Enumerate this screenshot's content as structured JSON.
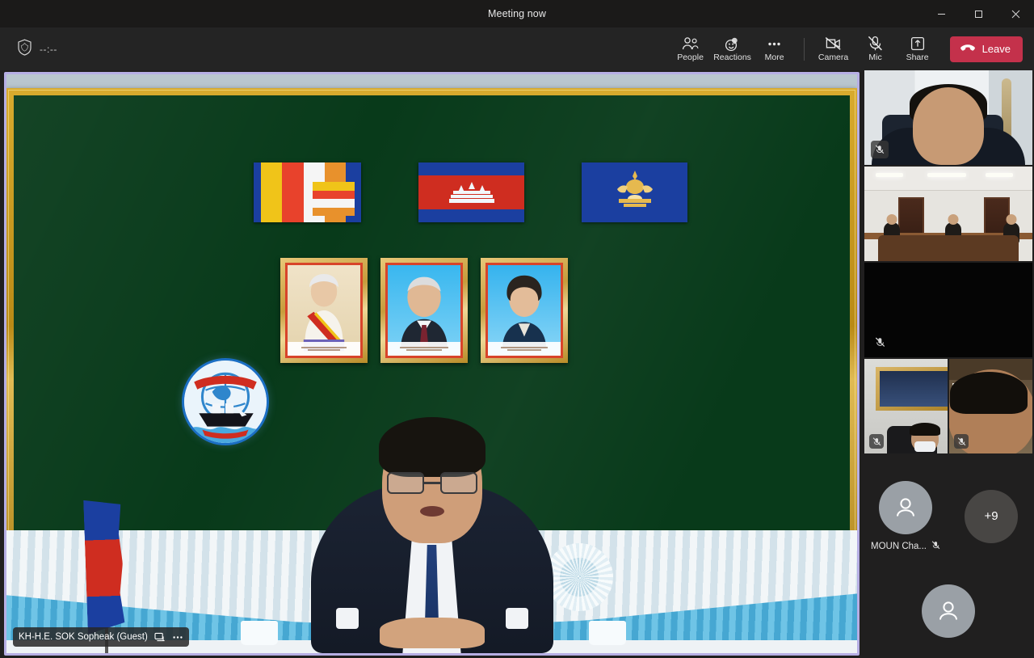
{
  "window": {
    "title": "Meeting now",
    "controls": [
      {
        "name": "minimize",
        "glyph": "–"
      },
      {
        "name": "maximize",
        "glyph": "❐"
      },
      {
        "name": "close",
        "glyph": "✕"
      }
    ]
  },
  "toolbar": {
    "shield_icon": "shield-icon",
    "timer": "--:--",
    "items": [
      {
        "label": "People",
        "icon": "people-icon"
      },
      {
        "label": "Reactions",
        "icon": "reactions-icon"
      },
      {
        "label": "More",
        "icon": "more-ellipsis-icon"
      },
      {
        "label": "Camera",
        "icon": "camera-off-icon"
      },
      {
        "label": "Mic",
        "icon": "mic-off-icon"
      },
      {
        "label": "Share",
        "icon": "share-tray-icon"
      }
    ],
    "leave_label": "Leave",
    "leave_color": "#c4314b"
  },
  "stage": {
    "active_speaker_border": "#b6aee4",
    "main_tile": {
      "name_label": "KH-H.E. SOK Sopheak (Guest)",
      "pin_icon": "pin-share-icon",
      "more_icon": "more-ellipsis-icon",
      "scene": {
        "backdrop": "dark-green-board",
        "board_color": "#083a1a",
        "frame_color": "#c79c2a",
        "wall_color": "#b3c1cb",
        "flags": [
          {
            "name": "buddhist-flag",
            "colors": [
              "#1b3fa0",
              "#f0c419",
              "#e8422c",
              "#ffffff",
              "#e8912c"
            ]
          },
          {
            "name": "cambodia-flag",
            "colors": [
              "#1b3fa0",
              "#cf2d20",
              "#ffffff"
            ]
          },
          {
            "name": "royal-standard-flag",
            "colors": [
              "#1b3fa0",
              "#e0b24a"
            ]
          }
        ],
        "portraits": [
          {
            "name": "king-portrait"
          },
          {
            "name": "king-father-portrait"
          },
          {
            "name": "queen-mother-portrait"
          }
        ],
        "emblem": {
          "name": "maritime-ship-emblem",
          "colors": [
            "#1b6fc4",
            "#cf2d20",
            "#ffffff"
          ]
        },
        "table_skirt_colors": [
          "#f2f6f8",
          "#46a7d2"
        ],
        "speaker": {
          "suit": "#1b2333",
          "tie": "#23407c",
          "glasses": true
        }
      }
    }
  },
  "roster": {
    "tiles": [
      {
        "name": "roster-tile-office",
        "muted": true,
        "camera_on": true
      },
      {
        "name": "roster-tile-conference-room",
        "muted": false,
        "camera_on": true
      },
      {
        "name": "roster-tile-camera-off",
        "muted": true,
        "camera_on": false
      },
      {
        "name": "roster-tile-framed-photo",
        "muted": true,
        "camera_on": true
      },
      {
        "name": "roster-tile-closeup",
        "muted": true,
        "camera_on": true
      }
    ],
    "avatars": [
      {
        "name": "MOUN Cha...",
        "muted": true,
        "type": "person"
      }
    ],
    "overflow_label": "+9",
    "extra_avatar": {
      "type": "person",
      "name": ""
    }
  }
}
